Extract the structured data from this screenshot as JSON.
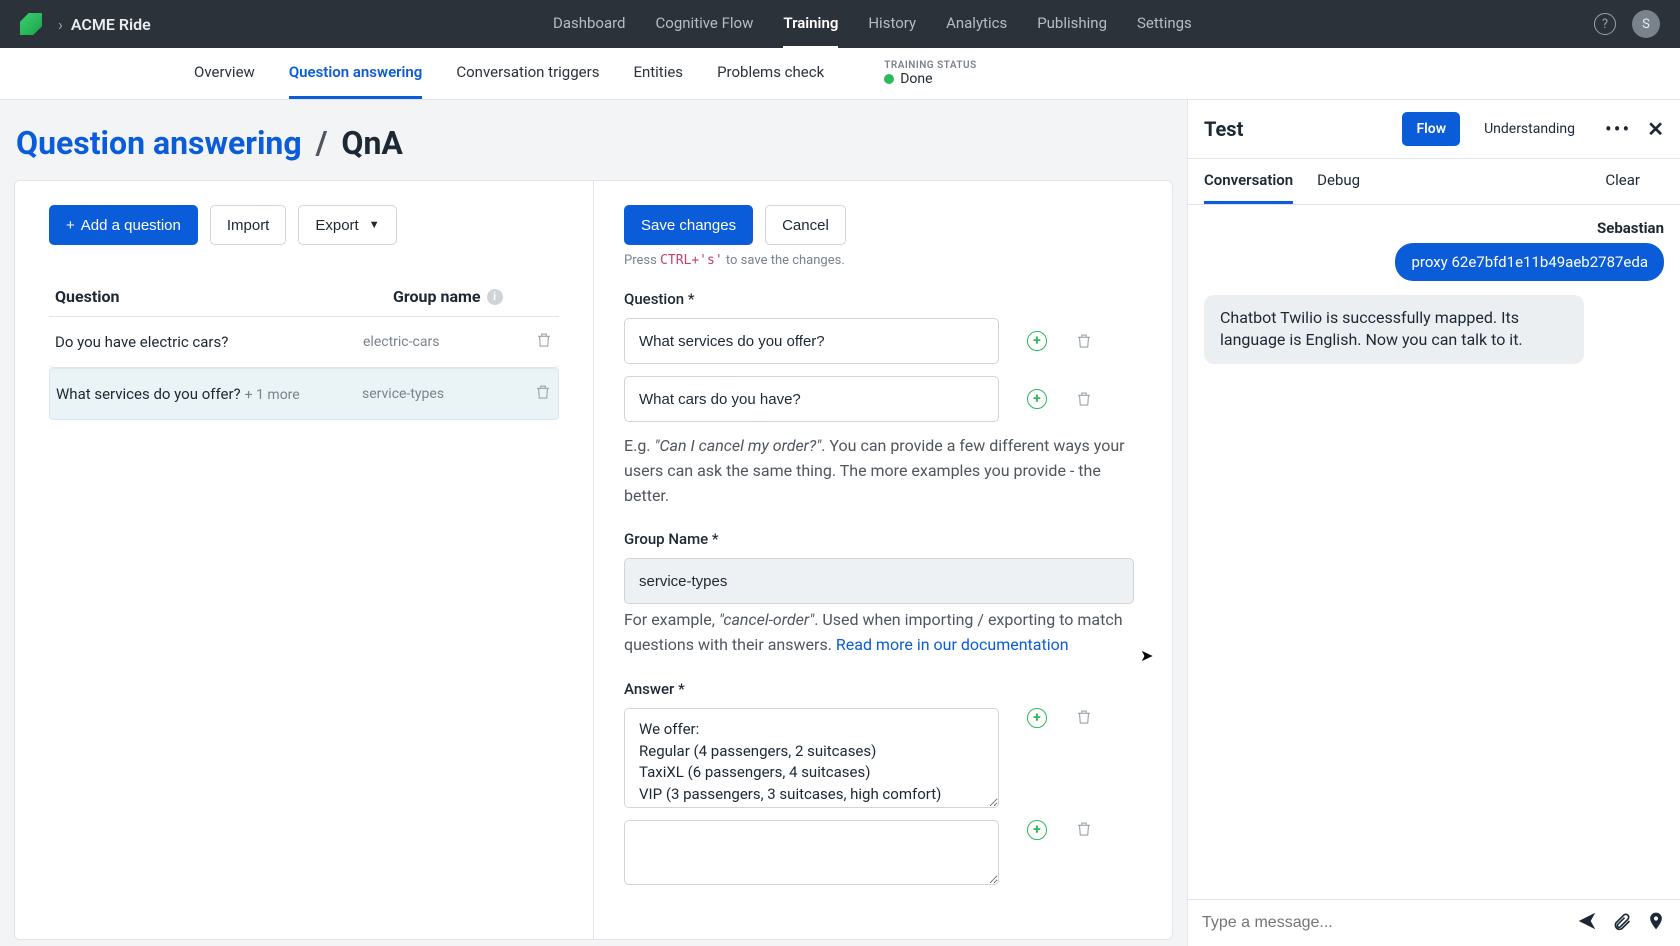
{
  "topbar": {
    "brand": "ACME Ride",
    "nav": [
      "Dashboard",
      "Cognitive Flow",
      "Training",
      "History",
      "Analytics",
      "Publishing",
      "Settings"
    ],
    "active_nav": "Training",
    "avatar_initial": "S"
  },
  "subnav": {
    "items": [
      "Overview",
      "Question answering",
      "Conversation triggers",
      "Entities",
      "Problems check"
    ],
    "active": "Question answering",
    "status_label": "TRAINING STATUS",
    "status_value": "Done"
  },
  "breadcrumb": {
    "parent": "Question answering",
    "current": "QnA"
  },
  "left": {
    "add_button": "Add a question",
    "import_button": "Import",
    "export_button": "Export",
    "col_question": "Question",
    "col_group": "Group name",
    "rows": [
      {
        "question": "Do you have electric cars?",
        "more": "",
        "group": "electric-cars",
        "selected": false
      },
      {
        "question": "What services do you offer?",
        "more": "+ 1 more",
        "group": "service-types",
        "selected": true
      }
    ]
  },
  "right": {
    "save_button": "Save changes",
    "cancel_button": "Cancel",
    "hint_prefix": "Press",
    "hint_keys": "CTRL+'s'",
    "hint_suffix": "to save the changes.",
    "question_label": "Question *",
    "questions": [
      "What services do you offer?",
      "What cars do you have?"
    ],
    "question_help_eg": "E.g.",
    "question_help_quote": "\"Can I cancel my order?\"",
    "question_help_rest": ". You can provide a few different ways your users can ask the same thing. The more examples you provide - the better.",
    "group_label": "Group Name *",
    "group_value": "service-types",
    "group_help_prefix": "For example,",
    "group_help_quote": "\"cancel-order\"",
    "group_help_rest": ". Used when importing / exporting to match questions with their answers.",
    "group_help_link": "Read more in our documentation",
    "answer_label": "Answer *",
    "answer_value": "We offer:\nRegular (4 passengers, 2 suitcases)\nTaxiXL (6 passengers, 4 suitcases)\nVIP (3 passengers, 3 suitcases, high comfort)"
  },
  "test": {
    "title": "Test",
    "flow": "Flow",
    "understanding": "Understanding",
    "tab_conversation": "Conversation",
    "tab_debug": "Debug",
    "clear": "Clear",
    "user_name": "Sebastian",
    "user_msg": "proxy 62e7bfd1e11b49aeb2787eda",
    "bot_msg": "Chatbot Twilio is successfully mapped. Its language is English. Now you can talk to it.",
    "input_placeholder": "Type a message..."
  }
}
